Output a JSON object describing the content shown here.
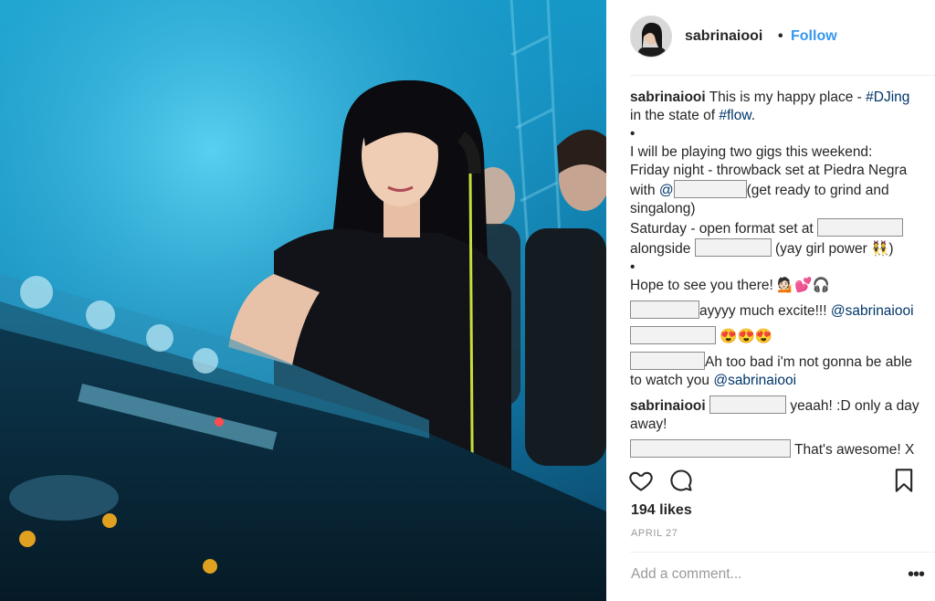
{
  "post": {
    "username": "sabrinaiooi",
    "separator": "•",
    "follow_label": "Follow",
    "caption": {
      "username": "sabrinaiooi",
      "line1": " This is my happy place - ",
      "tag1": "#DJing",
      "line2": " in the state of ",
      "tag2": "#flow",
      "line2_end": ".",
      "bullet1": "•",
      "gigs_intro": "I will be playing two gigs this weekend:",
      "friday_a": "Friday night - throwback set at Piedra Negra with ",
      "friday_at": "@",
      "friday_b": "(get ready to grind and singalong)",
      "saturday_a": "Saturday - open format set at ",
      "saturday_b": "alongside ",
      "saturday_c": " (yay girl power 👯)",
      "bullet2": "•",
      "closing": "Hope to see you there! 💁🏻💕🎧"
    },
    "comments": [
      {
        "text": "ayyyy much excite!!!",
        "mention": "@sabrinaiooi"
      },
      {
        "text": "😍😍😍"
      },
      {
        "text": "Ah too bad i'm not gonna be able to watch you ",
        "mention": "@sabrinaiooi"
      },
      {
        "username": "sabrinaiooi",
        "text": "yeaah! :D only a day away!"
      },
      {
        "text": "That's awesome! X"
      }
    ],
    "likes": "194 likes",
    "date": "APRIL 27",
    "add_comment_placeholder": "Add a comment...",
    "more_label": "•••"
  },
  "icons": {
    "like": "heart-icon",
    "comment": "speech-bubble-icon",
    "save": "bookmark-icon",
    "more": "more-options-icon"
  },
  "colors": {
    "link": "#3897f0",
    "hashtag": "#003569",
    "muted": "#999999",
    "photo_accent": "#17a8d4"
  }
}
